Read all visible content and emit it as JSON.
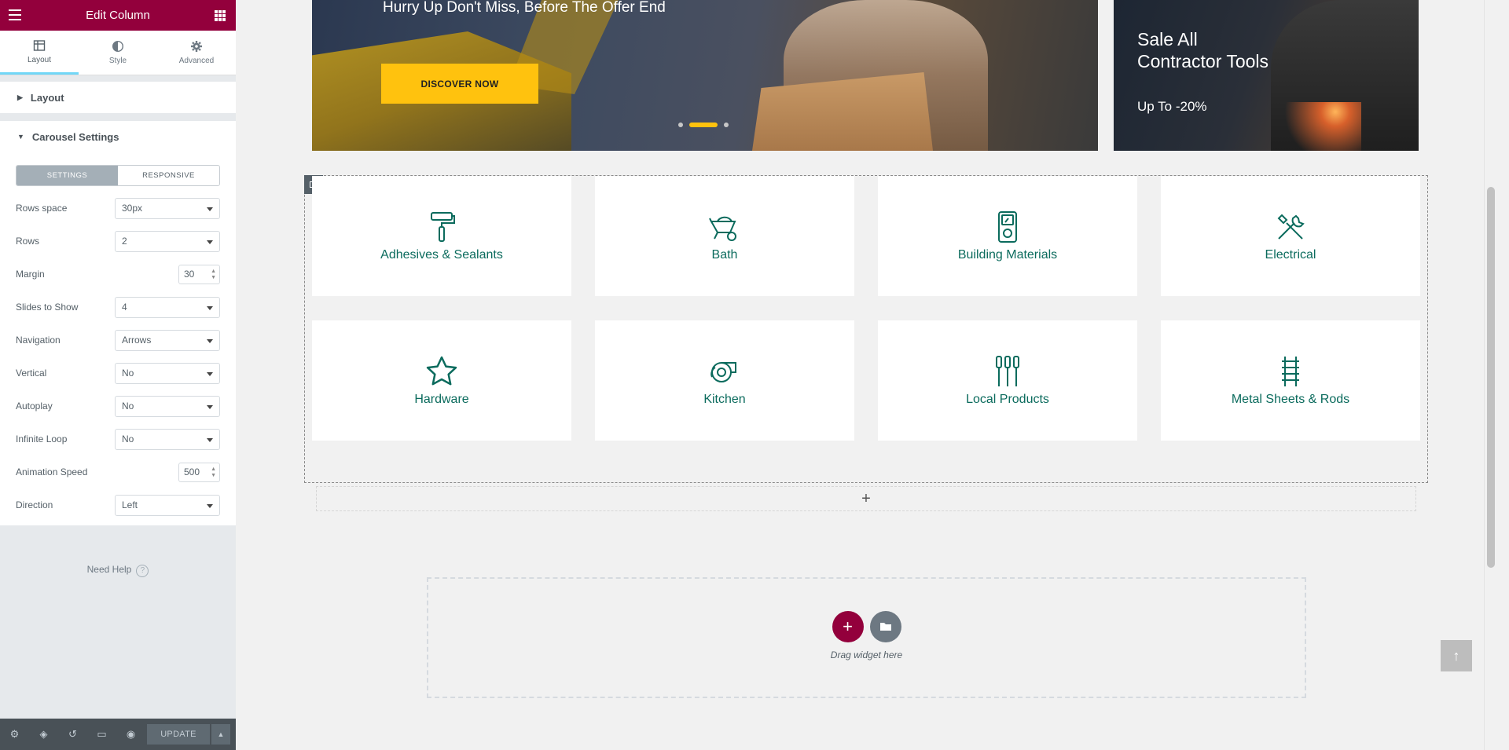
{
  "sidebar": {
    "title": "Edit Column",
    "tabs": [
      {
        "label": "Layout",
        "icon": "layout-icon"
      },
      {
        "label": "Style",
        "icon": "style-icon"
      },
      {
        "label": "Advanced",
        "icon": "gear-icon"
      }
    ],
    "section_layout": "Layout",
    "section_carousel": "Carousel Settings",
    "segment": {
      "settings": "SETTINGS",
      "responsive": "RESPONSIVE"
    },
    "controls": {
      "rows_space": {
        "label": "Rows space",
        "value": "30px"
      },
      "rows": {
        "label": "Rows",
        "value": "2"
      },
      "margin": {
        "label": "Margin",
        "value": "30"
      },
      "slides_to_show": {
        "label": "Slides to Show",
        "value": "4"
      },
      "navigation": {
        "label": "Navigation",
        "value": "Arrows"
      },
      "vertical": {
        "label": "Vertical",
        "value": "No"
      },
      "autoplay": {
        "label": "Autoplay",
        "value": "No"
      },
      "infinite_loop": {
        "label": "Infinite Loop",
        "value": "No"
      },
      "animation_speed": {
        "label": "Animation Speed",
        "value": "500"
      },
      "direction": {
        "label": "Direction",
        "value": "Left"
      }
    },
    "need_help": "Need Help",
    "footer": {
      "update": "UPDATE"
    },
    "accent_color": "#93003c"
  },
  "banner_main": {
    "tagline": "Hurry Up Don't Miss, Before The Offer End",
    "button": "DISCOVER NOW",
    "button_color": "#ffc20e"
  },
  "banner_side": {
    "title_line1": "Sale All",
    "title_line2": "Contractor Tools",
    "subtitle": "Up To -20%"
  },
  "categories": [
    {
      "name": "Adhesives & Sealants",
      "icon": "paint-roller-icon"
    },
    {
      "name": "Bath",
      "icon": "wheelbarrow-icon"
    },
    {
      "name": "Building Materials",
      "icon": "multimeter-icon"
    },
    {
      "name": "Electrical",
      "icon": "wrench-screwdriver-icon"
    },
    {
      "name": "Hardware",
      "icon": "star-icon"
    },
    {
      "name": "Kitchen",
      "icon": "tape-measure-icon"
    },
    {
      "name": "Local Products",
      "icon": "screwdrivers-icon"
    },
    {
      "name": "Metal Sheets & Rods",
      "icon": "metal-sheets-icon"
    }
  ],
  "category_color": "#0b6b5d",
  "drop_zone": {
    "hint": "Drag widget here"
  }
}
